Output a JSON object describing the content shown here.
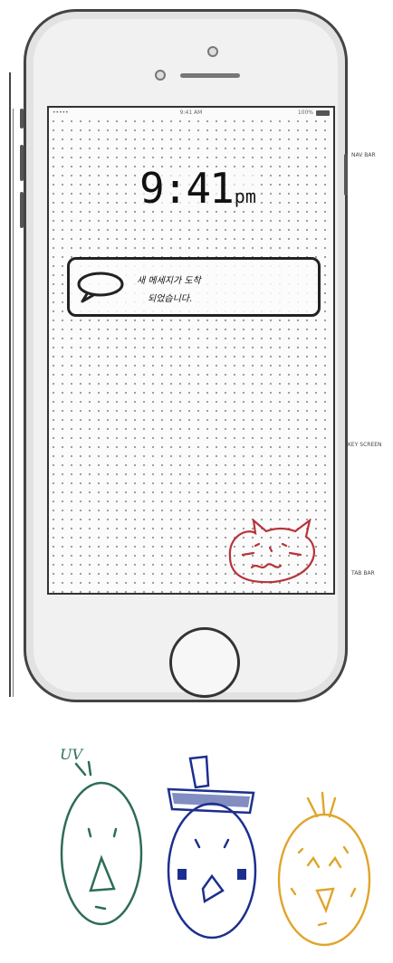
{
  "status_bar": {
    "carrier": "•••••",
    "time": "9:41 AM",
    "battery": "100%"
  },
  "lock_screen": {
    "clock_time": "9:41",
    "clock_period": "pm"
  },
  "notification": {
    "line1": "새 메세지가 도착",
    "line2": "되었습니다."
  },
  "annotations": {
    "top": "NAV BAR",
    "middle": "KEY SCREEN",
    "bottom": "TAB BAR"
  },
  "sketch_note": "UV",
  "colors": {
    "sketch_green": "#2e6d55",
    "sketch_blue": "#1c2f8f",
    "sketch_orange": "#e0a52a",
    "cat_red": "#b8333a"
  },
  "icons": {
    "chat": "speech-bubble-icon",
    "cat": "cat-face-icon"
  }
}
